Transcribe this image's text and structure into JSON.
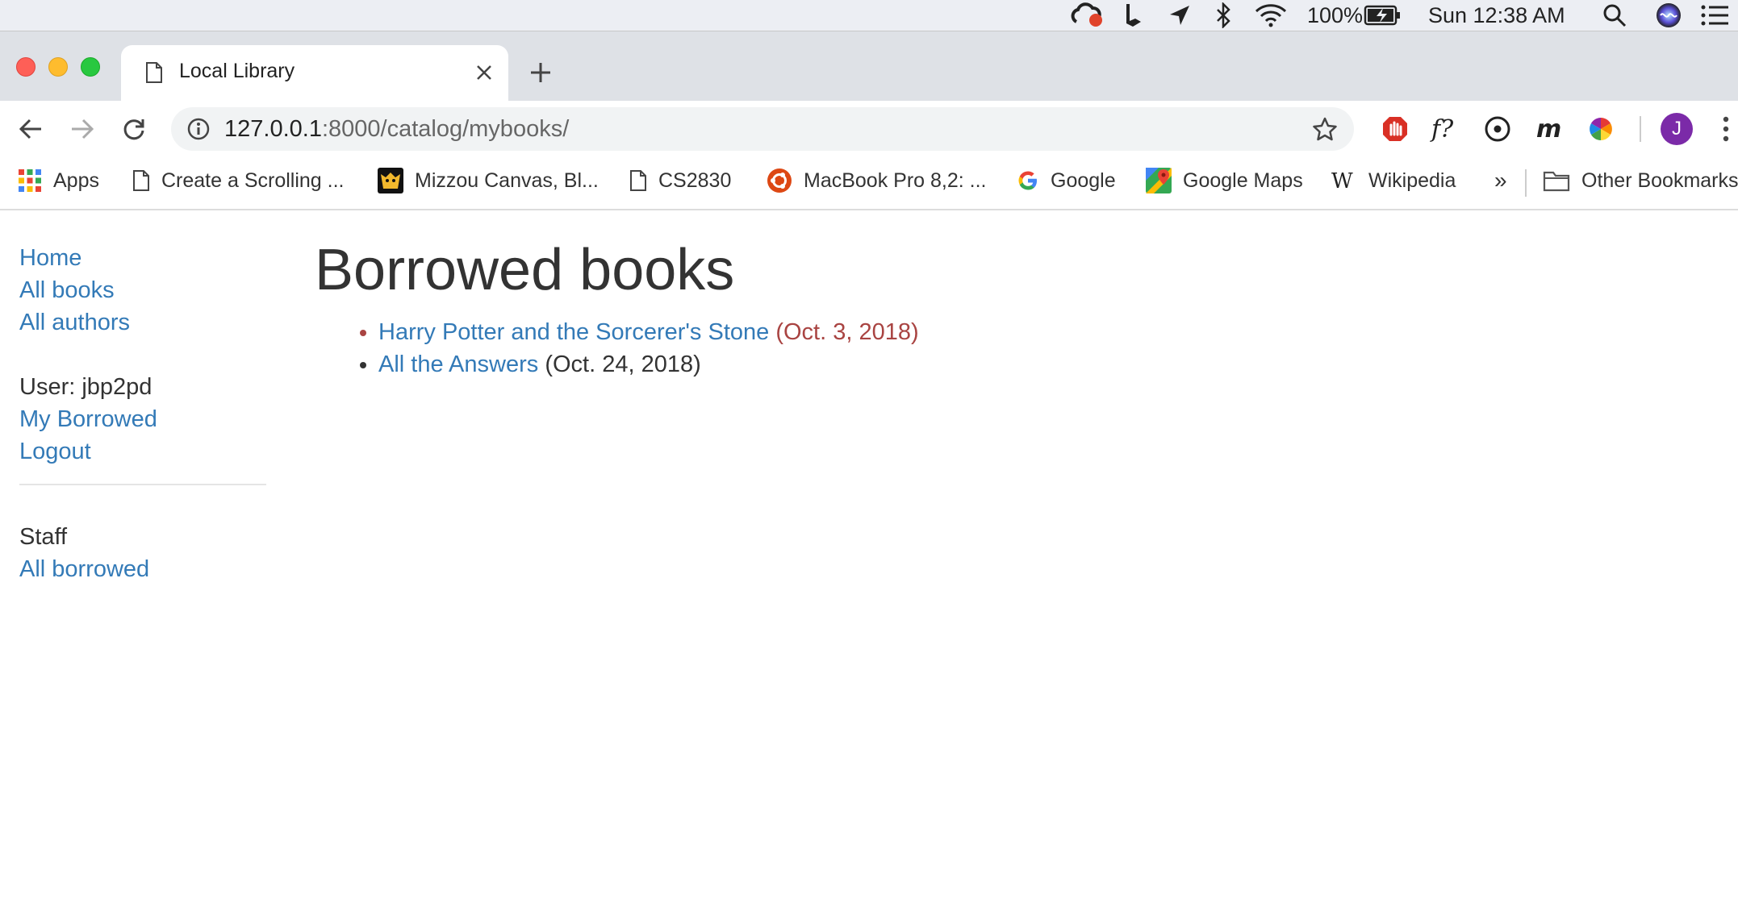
{
  "menubar": {
    "battery": "100%",
    "clock": "Sun 12:38 AM"
  },
  "browser": {
    "tab_title": "Local Library",
    "url_host": "127.0.0.1",
    "url_path": ":8000/catalog/mybooks/",
    "profile_initial": "J",
    "bookmarks": [
      {
        "label": "Apps"
      },
      {
        "label": "Create a Scrolling ..."
      },
      {
        "label": "Mizzou Canvas, Bl..."
      },
      {
        "label": "CS2830"
      },
      {
        "label": "MacBook Pro 8,2: ..."
      },
      {
        "label": "Google"
      },
      {
        "label": "Google Maps"
      },
      {
        "label": "Wikipedia"
      }
    ],
    "overflow": "»",
    "other_bookmarks": "Other Bookmarks"
  },
  "sidebar": {
    "home": "Home",
    "all_books": "All books",
    "all_authors": "All authors",
    "user": "User: jbp2pd",
    "my_borrowed": "My Borrowed",
    "logout": "Logout",
    "staff": "Staff",
    "all_borrowed": "All borrowed"
  },
  "page": {
    "title": "Borrowed books",
    "books": [
      {
        "title": "Harry Potter and the Sorcerer's Stone",
        "due": "(Oct. 3, 2018)",
        "overdue": true
      },
      {
        "title": "All the Answers",
        "due": "(Oct. 24, 2018)",
        "overdue": false
      }
    ]
  },
  "colors": {
    "link": "#337ab7",
    "overdue": "#a94442"
  }
}
